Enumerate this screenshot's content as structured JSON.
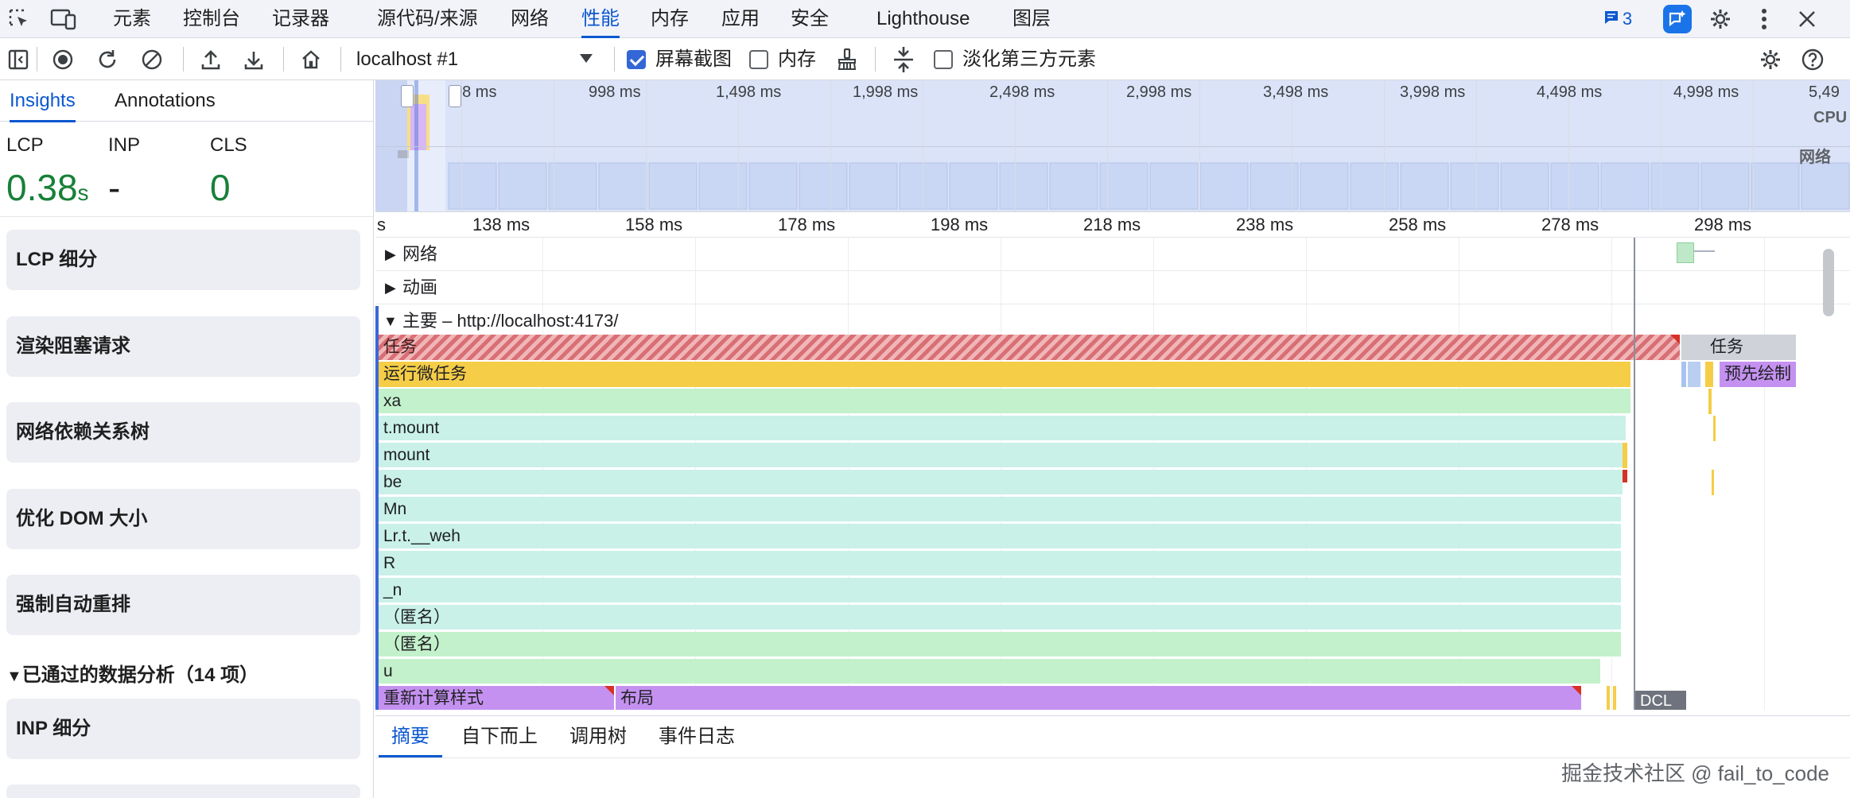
{
  "tabs": [
    {
      "label": "元素"
    },
    {
      "label": "控制台"
    },
    {
      "label": "记录器"
    },
    {
      "label": "源代码/来源"
    },
    {
      "label": "网络"
    },
    {
      "label": "性能"
    },
    {
      "label": "内存"
    },
    {
      "label": "应用"
    },
    {
      "label": "安全"
    },
    {
      "label": "Lighthouse"
    },
    {
      "label": "图层"
    }
  ],
  "active_tab": "性能",
  "issues_count": "3",
  "toolbar": {
    "target_select": "localhost #1",
    "screenshots_label": "屏幕截图",
    "screenshots_checked": true,
    "memory_label": "内存",
    "memory_checked": false,
    "dim_third_party_label": "淡化第三方元素",
    "dim_third_party_checked": false
  },
  "sidebar": {
    "tabs": [
      "Insights",
      "Annotations"
    ],
    "metrics": [
      {
        "label": "LCP",
        "value": "0.38",
        "unit": "s"
      },
      {
        "label": "INP",
        "value": "-"
      },
      {
        "label": "CLS",
        "value": "0"
      }
    ],
    "insights": [
      "LCP 细分",
      "渲染阻塞请求",
      "网络依赖关系树",
      "优化 DOM 大小",
      "强制自动重排"
    ],
    "passed_header": "已通过的数据分析（14 项）",
    "passed_items": [
      "INP 细分"
    ]
  },
  "overview": {
    "ticks": [
      "98 ms",
      "998 ms",
      "1,498 ms",
      "1,998 ms",
      "2,498 ms",
      "2,998 ms",
      "3,498 ms",
      "3,998 ms",
      "4,498 ms",
      "4,998 ms",
      "5,49"
    ],
    "cpu_label": "CPU",
    "network_label": "网络"
  },
  "ruler": {
    "first": "s",
    "ticks": [
      "138 ms",
      "158 ms",
      "178 ms",
      "198 ms",
      "218 ms",
      "238 ms",
      "258 ms",
      "278 ms",
      "298 ms"
    ]
  },
  "tracks": {
    "network": "网络",
    "animation": "动画",
    "main": "主要 – http://localhost:4173/"
  },
  "flame": {
    "task": "任务",
    "task_right": "任务",
    "microtask": "运行微任务",
    "prepaint": "预先绘制",
    "frames": [
      "xa",
      "t.mount",
      "mount",
      "be",
      "Mn",
      "Lr.t.__weh",
      "R",
      "_n",
      "（匿名）",
      "（匿名）",
      "u"
    ],
    "recalc_style": "重新计算样式",
    "layout": "布局",
    "dcl": "DCL"
  },
  "bottom_tabs": [
    "摘要",
    "自下而上",
    "调用树",
    "事件日志"
  ],
  "watermark": "掘金技术社区 @ fail_to_code",
  "colors": {
    "accent": "#0b57d0",
    "good": "#188038",
    "task": "#d86f74",
    "microtask": "#f5cd47",
    "script": "#c3f1cb",
    "render": "#c491f0"
  }
}
